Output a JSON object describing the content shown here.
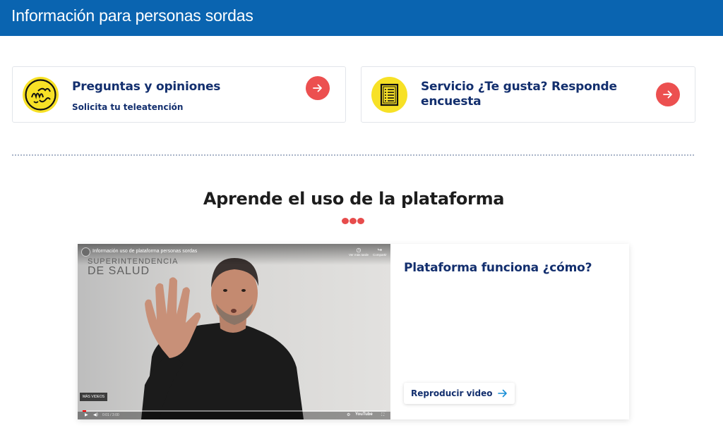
{
  "header": {
    "title": "Información para personas sordas"
  },
  "cards": [
    {
      "title": "Preguntas y opiniones",
      "subtitle": "Solicita tu teleatención",
      "icon": "sign-language-icon"
    },
    {
      "title_line1": "Servicio ¿Te gusta? Responde",
      "title_line2": "encuesta",
      "icon": "survey-document-icon"
    }
  ],
  "section": {
    "title": "Aprende el uso de la plataforma"
  },
  "video_card": {
    "title": "Plataforma funciona ¿cómo?",
    "button_label": "Reproducir video",
    "player": {
      "video_title": "Información uso de plataforma personas sordas",
      "watch_later": "Ver más tarde",
      "share": "Compartir",
      "watermark_line1": "SUPERINTENDENCIA",
      "watermark_line2": "DE SALUD",
      "more_videos": "MÁS VIDEOS",
      "time": "0:01 / 3:00",
      "brand": "YouTube",
      "progress": 0.01
    }
  },
  "colors": {
    "header": "#0a64b0",
    "title": "#132f6e",
    "accent": "#ec5050",
    "icon_bg": "#f7e126"
  }
}
